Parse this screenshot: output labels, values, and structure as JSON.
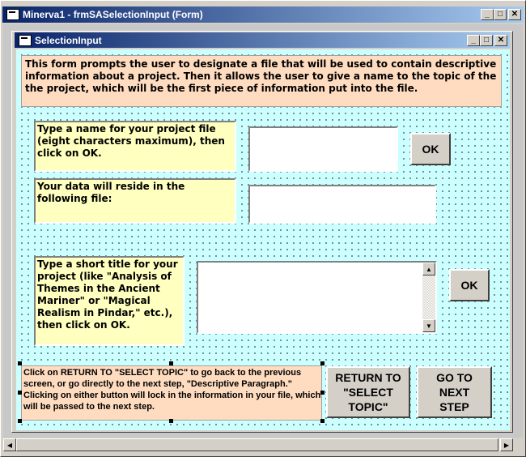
{
  "outer_window": {
    "title": "Minerva1 - frmSASelectionInput (Form)"
  },
  "inner_window": {
    "title": "SelectionInput"
  },
  "window_buttons": {
    "minimize": "_",
    "maximize": "□",
    "close": "✕"
  },
  "intro_text": "This form prompts the user to designate a file that will be used to contain descriptive information about a project.  Then it allows the user to give a name to the topic of the the project, which will be the first piece of information put into the file.",
  "project_file": {
    "label": "Type a name for your project file (eight characters maximum), then click on OK.",
    "value": "",
    "ok_label": "OK"
  },
  "data_file": {
    "label": "Your data will reside in the following file:",
    "value": ""
  },
  "project_title": {
    "label": "Type a short title for your project (like \"Analysis of Themes in the Ancient Mariner\" or \"Magical Realism in Pindar,\" etc.), then click on OK.",
    "value": "",
    "ok_label": "OK"
  },
  "footer_text": "Click on RETURN TO \"SELECT TOPIC\" to go back to the previous screen, or go directly to the next step, \"Descriptive Paragraph.\"  Clicking on either button will lock in the information in your file, which will be passed to the next step.",
  "return_button": {
    "label": "RETURN TO \"SELECT TOPIC\""
  },
  "next_button": {
    "label": "GO TO NEXT STEP"
  },
  "scroll_arrows": {
    "up": "▲",
    "down": "▼",
    "left": "◀",
    "right": "▶"
  },
  "colors": {
    "title_bar": "#0a246a",
    "form_background": "#ccffff",
    "yellow_label": "#ffffc0",
    "peach_label": "#ffdcc0"
  }
}
